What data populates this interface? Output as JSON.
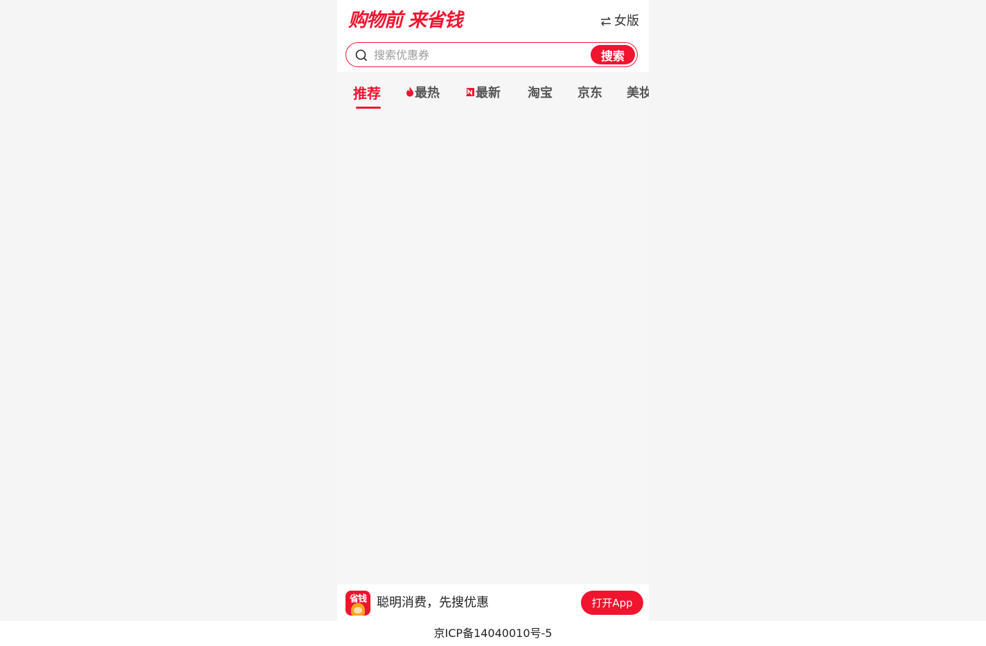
{
  "header": {
    "logo_text": "购物前 来省钱",
    "version_switch_label": "女版",
    "switch_icon": "swap-arrows-icon"
  },
  "search": {
    "placeholder": "搜索优惠券",
    "value": "",
    "button_label": "搜索",
    "icon": "search-icon"
  },
  "tabs": [
    {
      "label": "推荐",
      "active": true
    },
    {
      "label": "最热",
      "icon": "fire-icon"
    },
    {
      "label": "最新",
      "icon": "new-badge-icon"
    },
    {
      "label": "淘宝"
    },
    {
      "label": "京东"
    },
    {
      "label": "美妆"
    }
  ],
  "bottom_banner": {
    "app_icon_text": "省钱",
    "slogan": "聪明消费，先搜优惠",
    "open_app_label": "打开App"
  },
  "footer": {
    "icp": "京ICP备14040010号-5"
  },
  "colors": {
    "brand_red": "#f0142f",
    "background": "#f6f6f6"
  }
}
